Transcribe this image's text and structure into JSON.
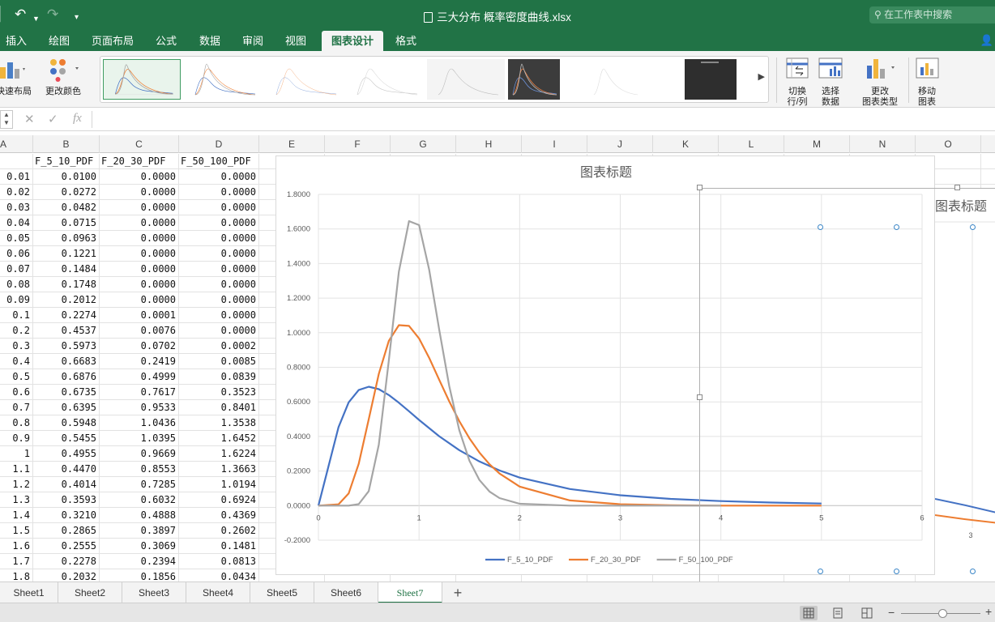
{
  "window": {
    "title": "三大分布 概率密度曲线.xlsx",
    "search_placeholder": "在工作表中搜索"
  },
  "ribbon_tabs": [
    {
      "label": "插入",
      "active": false
    },
    {
      "label": "绘图",
      "active": false
    },
    {
      "label": "页面布局",
      "active": false
    },
    {
      "label": "公式",
      "active": false
    },
    {
      "label": "数据",
      "active": false
    },
    {
      "label": "审阅",
      "active": false
    },
    {
      "label": "视图",
      "active": false
    },
    {
      "label": "图表设计",
      "active": true
    },
    {
      "label": "格式",
      "active": false
    }
  ],
  "ribbon": {
    "quick_layout": "快速布局",
    "change_colors": "更改颜色",
    "switch_row_col": [
      "切换",
      "行/列"
    ],
    "select_data": [
      "选择",
      "数据"
    ],
    "change_chart_type": [
      "更改",
      "图表类型"
    ],
    "move_chart": [
      "移动",
      "图表"
    ]
  },
  "formula_bar": {
    "fx": "fx",
    "value": ""
  },
  "columns": [
    "A",
    "B",
    "C",
    "D",
    "E",
    "F",
    "G",
    "H",
    "I",
    "J",
    "K",
    "L",
    "M",
    "N",
    "O"
  ],
  "table": {
    "headers": [
      "",
      "F_5_10_PDF",
      "F_20_30_PDF",
      "F_50_100_PDF"
    ],
    "rows": [
      [
        "0.01",
        "0.0100",
        "0.0000",
        "0.0000"
      ],
      [
        "0.02",
        "0.0272",
        "0.0000",
        "0.0000"
      ],
      [
        "0.03",
        "0.0482",
        "0.0000",
        "0.0000"
      ],
      [
        "0.04",
        "0.0715",
        "0.0000",
        "0.0000"
      ],
      [
        "0.05",
        "0.0963",
        "0.0000",
        "0.0000"
      ],
      [
        "0.06",
        "0.1221",
        "0.0000",
        "0.0000"
      ],
      [
        "0.07",
        "0.1484",
        "0.0000",
        "0.0000"
      ],
      [
        "0.08",
        "0.1748",
        "0.0000",
        "0.0000"
      ],
      [
        "0.09",
        "0.2012",
        "0.0000",
        "0.0000"
      ],
      [
        "0.1",
        "0.2274",
        "0.0001",
        "0.0000"
      ],
      [
        "0.2",
        "0.4537",
        "0.0076",
        "0.0000"
      ],
      [
        "0.3",
        "0.5973",
        "0.0702",
        "0.0002"
      ],
      [
        "0.4",
        "0.6683",
        "0.2419",
        "0.0085"
      ],
      [
        "0.5",
        "0.6876",
        "0.4999",
        "0.0839"
      ],
      [
        "0.6",
        "0.6735",
        "0.7617",
        "0.3523"
      ],
      [
        "0.7",
        "0.6395",
        "0.9533",
        "0.8401"
      ],
      [
        "0.8",
        "0.5948",
        "1.0436",
        "1.3538"
      ],
      [
        "0.9",
        "0.5455",
        "1.0395",
        "1.6452"
      ],
      [
        "1",
        "0.4955",
        "0.9669",
        "1.6224"
      ],
      [
        "1.1",
        "0.4470",
        "0.8553",
        "1.3663"
      ],
      [
        "1.2",
        "0.4014",
        "0.7285",
        "1.0194"
      ],
      [
        "1.3",
        "0.3593",
        "0.6032",
        "0.6924"
      ],
      [
        "1.4",
        "0.3210",
        "0.4888",
        "0.4369"
      ],
      [
        "1.5",
        "0.2865",
        "0.3897",
        "0.2602"
      ],
      [
        "1.6",
        "0.2555",
        "0.3069",
        "0.1481"
      ],
      [
        "1.7",
        "0.2278",
        "0.2394",
        "0.0813"
      ],
      [
        "1.8",
        "0.2032",
        "0.1856",
        "0.0434"
      ]
    ]
  },
  "chart_data": {
    "type": "line",
    "title": "图表标题",
    "ylim": [
      -0.2,
      1.8
    ],
    "xlim": [
      0,
      6
    ],
    "yticks": [
      "1.8000",
      "1.6000",
      "1.4000",
      "1.2000",
      "1.0000",
      "0.8000",
      "0.6000",
      "0.4000",
      "0.2000",
      "0.0000",
      "-0.2000"
    ],
    "xticks": [
      "0",
      "1",
      "2",
      "3",
      "4",
      "5",
      "6"
    ],
    "grid": true,
    "legend": "bottom",
    "series": [
      {
        "name": "F_5_10_PDF",
        "color": "#4472c4",
        "points": [
          [
            0,
            0
          ],
          [
            0.1,
            0.2274
          ],
          [
            0.2,
            0.4537
          ],
          [
            0.3,
            0.5973
          ],
          [
            0.4,
            0.6683
          ],
          [
            0.5,
            0.6876
          ],
          [
            0.6,
            0.6735
          ],
          [
            0.7,
            0.6395
          ],
          [
            0.8,
            0.5948
          ],
          [
            0.9,
            0.5455
          ],
          [
            1,
            0.4955
          ],
          [
            1.2,
            0.4014
          ],
          [
            1.4,
            0.321
          ],
          [
            1.6,
            0.2555
          ],
          [
            1.8,
            0.2032
          ],
          [
            2,
            0.162
          ],
          [
            2.5,
            0.096
          ],
          [
            3,
            0.06
          ],
          [
            3.5,
            0.039
          ],
          [
            4,
            0.026
          ],
          [
            4.5,
            0.018
          ],
          [
            5,
            0.012
          ]
        ]
      },
      {
        "name": "F_20_30_PDF",
        "color": "#ed7d31",
        "points": [
          [
            0,
            0
          ],
          [
            0.2,
            0.0076
          ],
          [
            0.3,
            0.0702
          ],
          [
            0.4,
            0.2419
          ],
          [
            0.5,
            0.4999
          ],
          [
            0.6,
            0.7617
          ],
          [
            0.7,
            0.9533
          ],
          [
            0.8,
            1.0436
          ],
          [
            0.9,
            1.0395
          ],
          [
            1,
            0.9669
          ],
          [
            1.1,
            0.8553
          ],
          [
            1.2,
            0.7285
          ],
          [
            1.3,
            0.6032
          ],
          [
            1.4,
            0.4888
          ],
          [
            1.5,
            0.3897
          ],
          [
            1.6,
            0.3069
          ],
          [
            1.7,
            0.2394
          ],
          [
            1.8,
            0.1856
          ],
          [
            2,
            0.11
          ],
          [
            2.5,
            0.03
          ],
          [
            3,
            0.008
          ],
          [
            3.5,
            0.002
          ],
          [
            4,
            0
          ],
          [
            5,
            0
          ]
        ]
      },
      {
        "name": "F_50_100_PDF",
        "color": "#a5a5a5",
        "points": [
          [
            0,
            0
          ],
          [
            0.3,
            0.0002
          ],
          [
            0.4,
            0.0085
          ],
          [
            0.5,
            0.0839
          ],
          [
            0.6,
            0.3523
          ],
          [
            0.7,
            0.8401
          ],
          [
            0.8,
            1.3538
          ],
          [
            0.9,
            1.6452
          ],
          [
            1,
            1.6224
          ],
          [
            1.1,
            1.3663
          ],
          [
            1.2,
            1.0194
          ],
          [
            1.3,
            0.6924
          ],
          [
            1.4,
            0.4369
          ],
          [
            1.5,
            0.2602
          ],
          [
            1.6,
            0.1481
          ],
          [
            1.7,
            0.0813
          ],
          [
            1.8,
            0.0434
          ],
          [
            2,
            0.011
          ],
          [
            2.5,
            0
          ],
          [
            3,
            0
          ],
          [
            4,
            0
          ]
        ]
      }
    ]
  },
  "second_chart": {
    "title": "图表标题",
    "xtick": "3"
  },
  "sheets": [
    {
      "label": "Sheet1",
      "active": false
    },
    {
      "label": "Sheet2",
      "active": false
    },
    {
      "label": "Sheet3",
      "active": false
    },
    {
      "label": "Sheet4",
      "active": false
    },
    {
      "label": "Sheet5",
      "active": false
    },
    {
      "label": "Sheet6",
      "active": false
    },
    {
      "label": "Sheet7",
      "active": true
    }
  ],
  "add_sheet": "+"
}
